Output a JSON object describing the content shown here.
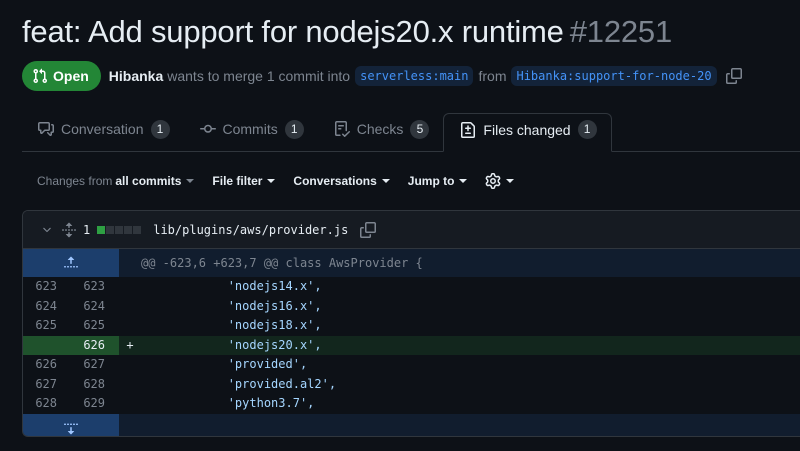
{
  "pr": {
    "title": "feat: Add support for nodejs20.x runtime",
    "number": "#12251",
    "status": "Open",
    "author": "Hibanka",
    "merge_text": "wants to merge 1 commit into",
    "base_branch": "serverless:main",
    "from_text": "from",
    "head_branch": "Hibanka:support-for-node-20"
  },
  "tabs": [
    {
      "label": "Conversation",
      "count": "1",
      "icon": "comment-discussion-icon"
    },
    {
      "label": "Commits",
      "count": "1",
      "icon": "git-commit-icon"
    },
    {
      "label": "Checks",
      "count": "5",
      "icon": "checklist-icon"
    },
    {
      "label": "Files changed",
      "count": "1",
      "icon": "file-diff-icon",
      "active": true
    }
  ],
  "toolbar": {
    "changes_prefix": "Changes from",
    "changes_value": "all commits",
    "file_filter": "File filter",
    "conversations": "Conversations",
    "jump_to": "Jump to"
  },
  "file": {
    "changes": "1",
    "path": "lib/plugins/aws/provider.js",
    "hunk_header": "@@ -623,6 +623,7 @@ class AwsProvider {",
    "lines": [
      {
        "old": "623",
        "new": "623",
        "sign": "",
        "text": "            'nodejs14.x',",
        "type": "context"
      },
      {
        "old": "624",
        "new": "624",
        "sign": "",
        "text": "            'nodejs16.x',",
        "type": "context"
      },
      {
        "old": "625",
        "new": "625",
        "sign": "",
        "text": "            'nodejs18.x',",
        "type": "context"
      },
      {
        "old": "",
        "new": "626",
        "sign": "+",
        "text": "            'nodejs20.x',",
        "type": "add"
      },
      {
        "old": "626",
        "new": "627",
        "sign": "",
        "text": "            'provided',",
        "type": "context"
      },
      {
        "old": "627",
        "new": "628",
        "sign": "",
        "text": "            'provided.al2',",
        "type": "context"
      },
      {
        "old": "628",
        "new": "629",
        "sign": "",
        "text": "            'python3.7',",
        "type": "context"
      }
    ]
  },
  "colors": {
    "background": "#0d1117",
    "open_badge": "#238636",
    "branch_text": "#4493f8",
    "addition": "#2ea043",
    "muted": "#7d8590"
  }
}
